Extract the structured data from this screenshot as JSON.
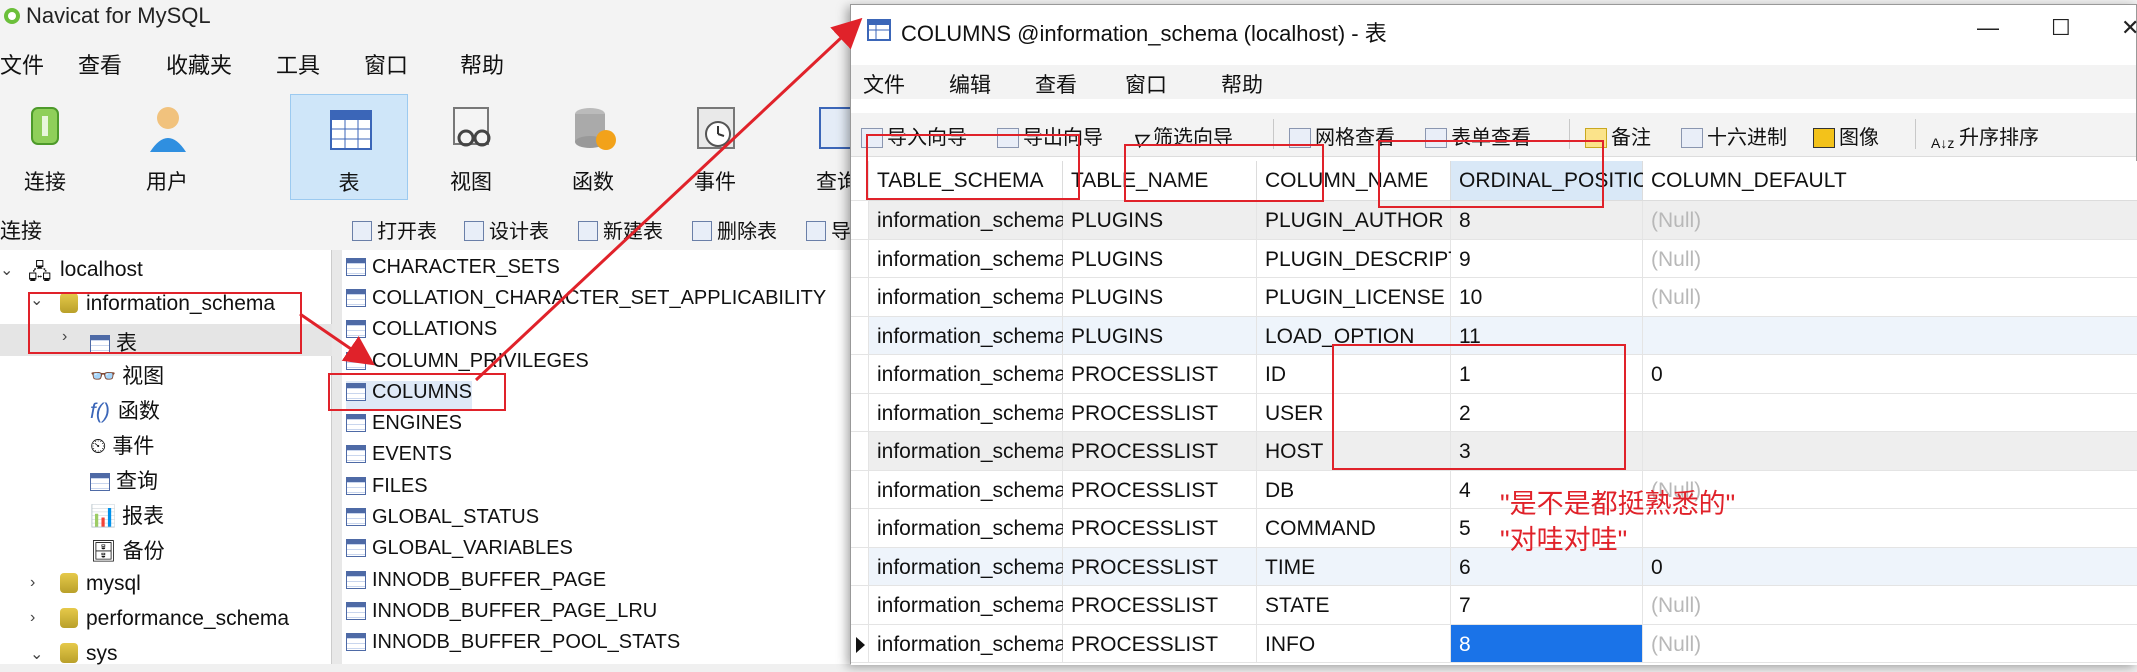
{
  "main_window": {
    "title": "Navicat for MySQL",
    "menu": [
      "文件",
      "查看",
      "收藏夹",
      "工具",
      "窗口",
      "帮助"
    ],
    "toolbar": [
      {
        "label": "连接",
        "icon": "connection-icon"
      },
      {
        "label": "用户",
        "icon": "user-icon"
      },
      {
        "label": "表",
        "icon": "table-icon"
      },
      {
        "label": "视图",
        "icon": "view-icon"
      },
      {
        "label": "函数",
        "icon": "function-icon"
      },
      {
        "label": "事件",
        "icon": "event-icon"
      },
      {
        "label": "查询",
        "icon": "query-icon"
      }
    ],
    "connection_label": "连接",
    "object_toolbar": [
      "打开表",
      "设计表",
      "新建表",
      "删除表",
      "导"
    ],
    "tree": {
      "connection": "localhost",
      "databases": [
        {
          "name": "information_schema",
          "expanded": true
        },
        {
          "name": "mysql"
        },
        {
          "name": "performance_schema"
        },
        {
          "name": "sys"
        }
      ],
      "children": [
        "表",
        "视图",
        "函数",
        "事件",
        "查询",
        "报表",
        "备份"
      ]
    },
    "objects": [
      "CHARACTER_SETS",
      "COLLATION_CHARACTER_SET_APPLICABILITY",
      "COLLATIONS",
      "COLUMN_PRIVILEGES",
      "COLUMNS",
      "ENGINES",
      "EVENTS",
      "FILES",
      "GLOBAL_STATUS",
      "GLOBAL_VARIABLES",
      "INNODB_BUFFER_PAGE",
      "INNODB_BUFFER_PAGE_LRU",
      "INNODB_BUFFER_POOL_STATS"
    ]
  },
  "columns_window": {
    "title": "COLUMNS @information_schema (localhost) - 表",
    "controls": {
      "minimize": "—",
      "maximize": "☐",
      "close": "✕"
    },
    "menu": [
      "文件",
      "编辑",
      "查看",
      "窗口",
      "帮助"
    ],
    "toolbar": [
      "导入向导",
      "导出向导",
      "筛选向导",
      "网格查看",
      "表单查看",
      "备注",
      "十六进制",
      "图像",
      "升序排序"
    ],
    "columns": [
      "TABLE_SCHEMA",
      "TABLE_NAME",
      "COLUMN_NAME",
      "ORDINAL_POSITION",
      "COLUMN_DEFAULT"
    ],
    "rows": [
      [
        "information_schema",
        "PLUGINS",
        "PLUGIN_AUTHOR",
        "8",
        "(Null)"
      ],
      [
        "information_schema",
        "PLUGINS",
        "PLUGIN_DESCRIPTION",
        "9",
        "(Null)"
      ],
      [
        "information_schema",
        "PLUGINS",
        "PLUGIN_LICENSE",
        "10",
        "(Null)"
      ],
      [
        "information_schema",
        "PLUGINS",
        "LOAD_OPTION",
        "11",
        ""
      ],
      [
        "information_schema",
        "PROCESSLIST",
        "ID",
        "1",
        "0"
      ],
      [
        "information_schema",
        "PROCESSLIST",
        "USER",
        "2",
        ""
      ],
      [
        "information_schema",
        "PROCESSLIST",
        "HOST",
        "3",
        ""
      ],
      [
        "information_schema",
        "PROCESSLIST",
        "DB",
        "4",
        "(Null)"
      ],
      [
        "information_schema",
        "PROCESSLIST",
        "COMMAND",
        "5",
        ""
      ],
      [
        "information_schema",
        "PROCESSLIST",
        "TIME",
        "6",
        "0"
      ],
      [
        "information_schema",
        "PROCESSLIST",
        "STATE",
        "7",
        "(Null)"
      ],
      [
        "information_schema",
        "PROCESSLIST",
        "INFO",
        "8",
        "(Null)"
      ]
    ]
  },
  "annotation": {
    "line1": "\"是不是都挺熟悉的\"",
    "line2": "\"对哇对哇\"",
    "color": "#e0222a"
  },
  "colors": {
    "selection": "#1a73e8",
    "toolbar_selected": "#cfe6f9",
    "header_highlight": "#d9e8f7"
  }
}
